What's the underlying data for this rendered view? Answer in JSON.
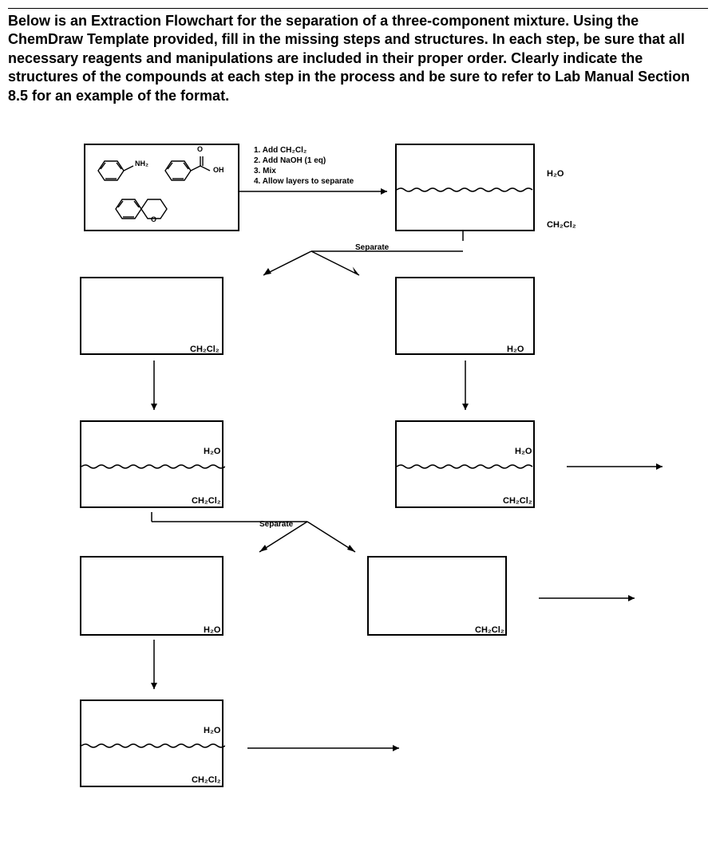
{
  "instruction": "Below is an Extraction Flowchart for the separation of a three-component mixture. Using the ChemDraw Template provided, fill in the missing steps and structures. In each step, be sure that all necessary reagents and manipulations are included in their proper order. Clearly indicate the structures of the compounds at each step in the process and be sure to refer to Lab Manual Section 8.5 for an example of the format.",
  "steps": {
    "s1": "1. Add CH₂Cl₂",
    "s2": "2. Add NaOH (1 eq)",
    "s3": "3. Mix",
    "s4": "4. Allow layers to separate"
  },
  "labels": {
    "h2o": "H₂O",
    "ch2cl2": "CH₂Cl₂",
    "separate": "Separate",
    "nh2": "NH₂",
    "oh": "OH",
    "o": "O"
  },
  "starting_compounds": [
    "aniline (benzene-NH2)",
    "benzoic acid (benzene-COOH)",
    "naphthalenone/chromone bicyclic with O"
  ],
  "flowchart": {
    "boxes": [
      {
        "id": "start",
        "contents": "three compounds: aniline, benzoic acid, bicyclic ketone"
      },
      {
        "id": "after_naoh",
        "top": "H2O layer",
        "bottom": "CH2Cl2 layer"
      },
      {
        "id": "left_ch2cl2",
        "label": "CH2Cl2"
      },
      {
        "id": "right_h2o",
        "label": "H2O"
      },
      {
        "id": "left_biphasic1",
        "top": "H2O",
        "bottom": "CH2Cl2"
      },
      {
        "id": "right_biphasic1",
        "top": "H2O",
        "bottom": "CH2Cl2"
      },
      {
        "id": "left_h2o",
        "label": "H2O"
      },
      {
        "id": "right_ch2cl2",
        "label": "CH2Cl2"
      },
      {
        "id": "left_biphasic2",
        "top": "H2O",
        "bottom": "CH2Cl2"
      }
    ]
  }
}
